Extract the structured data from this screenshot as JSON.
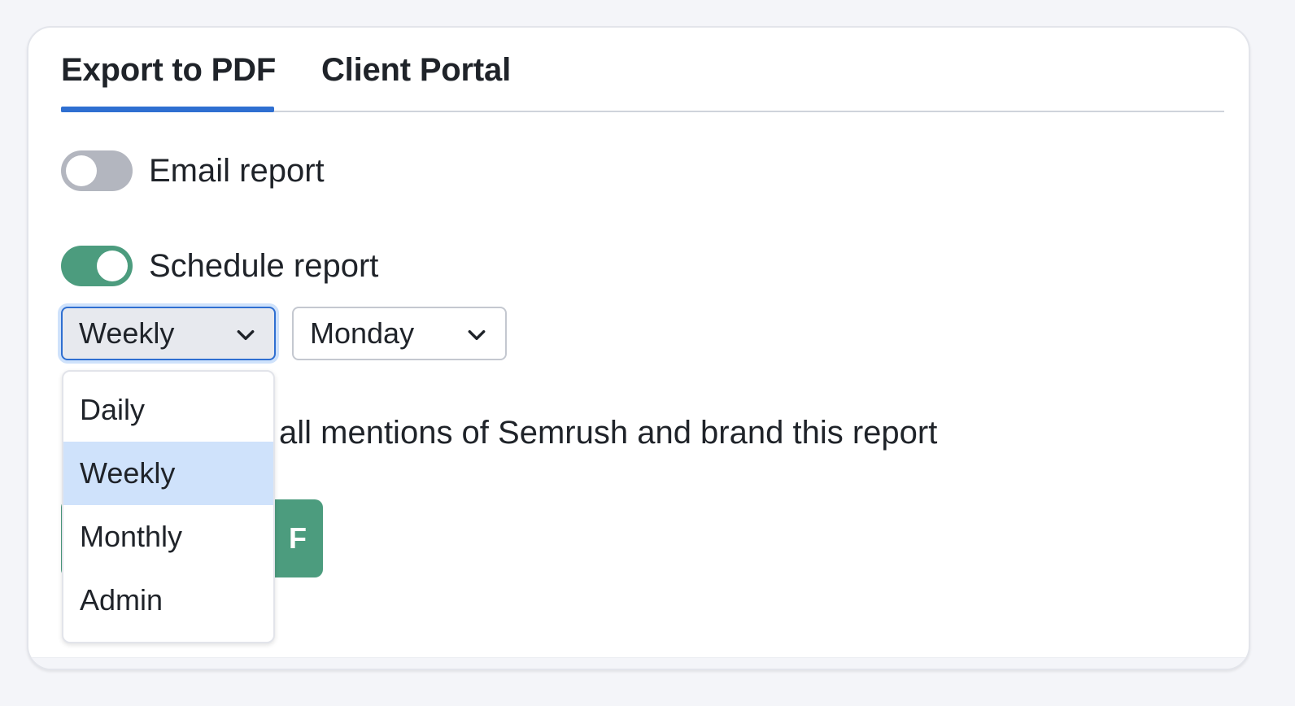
{
  "tabs": [
    {
      "label": "Export to PDF",
      "active": true
    },
    {
      "label": "Client Portal",
      "active": false
    }
  ],
  "email_report": {
    "label": "Email report",
    "enabled": false
  },
  "schedule_report": {
    "label": "Schedule report",
    "enabled": true
  },
  "frequency_select": {
    "value": "Weekly",
    "options": [
      "Daily",
      "Weekly",
      "Monthly",
      "Admin"
    ],
    "selected_index": 1
  },
  "day_select": {
    "value": "Monday"
  },
  "brand_option": {
    "label_visible": "all mentions of Semrush and brand this report"
  },
  "export_button": {
    "label_visible": "F"
  },
  "colors": {
    "accent_blue": "#2f6fd1",
    "toggle_on": "#4c9c7e",
    "toggle_off": "#b3b6bf",
    "option_highlight": "#cfe2fb",
    "button_green": "#4c9c7e"
  },
  "icons": {
    "select_chevron": "chevron-down-icon"
  }
}
